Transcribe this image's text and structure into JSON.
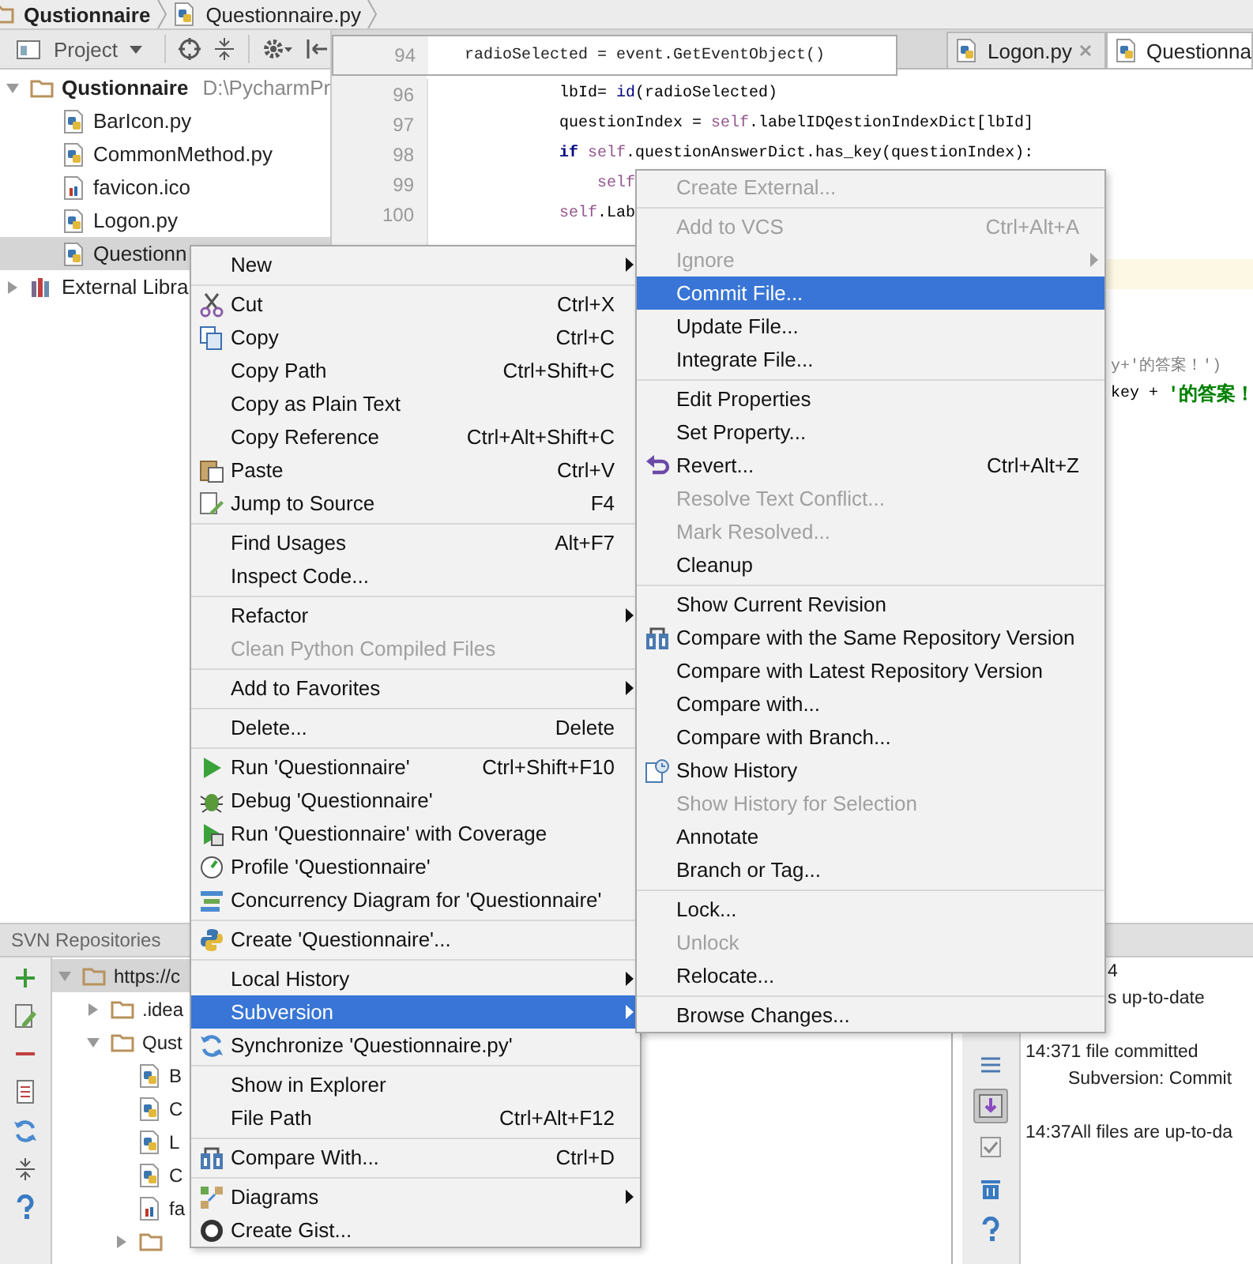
{
  "breadcrumb": [
    {
      "label": "Qustionnaire",
      "kind": "folder"
    },
    {
      "label": "Questionnaire.py",
      "kind": "python"
    }
  ],
  "project_panel": {
    "title": "Project",
    "tree": [
      {
        "label": "Qustionnaire",
        "path": "D:\\PycharmPr",
        "kind": "folder",
        "expanded": true,
        "selected": false,
        "children": [
          {
            "label": "BarIcon.py",
            "kind": "python",
            "selected": false
          },
          {
            "label": "CommonMethod.py",
            "kind": "python",
            "selected": false
          },
          {
            "label": "favicon.ico",
            "kind": "image",
            "selected": false
          },
          {
            "label": "Logon.py",
            "kind": "python",
            "selected": false
          },
          {
            "label": "Questionn",
            "kind": "python",
            "selected": true
          }
        ]
      },
      {
        "label": "External Libra",
        "kind": "library",
        "expanded": false,
        "selected": false
      }
    ]
  },
  "editor": {
    "sticky_line": {
      "number": "94",
      "code": "radioSelected = event.GetEventObject()"
    },
    "tabs": [
      {
        "label": "Logon.py",
        "selected": false,
        "closable": true
      },
      {
        "label": "Questionna",
        "selected": true,
        "closable": false
      }
    ],
    "lines": [
      {
        "number": "96",
        "current": false,
        "nested": false,
        "segments": [
          {
            "text": "lbId= ",
            "kind": "plain"
          },
          {
            "text": "id",
            "kind": "builtin"
          },
          {
            "text": "(radioSelected)",
            "kind": "plain"
          }
        ]
      },
      {
        "number": "97",
        "current": false,
        "nested": false,
        "segments": [
          {
            "text": "questionIndex = ",
            "kind": "plain"
          },
          {
            "text": "self",
            "kind": "self"
          },
          {
            "text": ".labelIDQestionIndexDict[lbId]",
            "kind": "plain"
          }
        ]
      },
      {
        "number": "98",
        "current": false,
        "nested": false,
        "segments": [
          {
            "text": "if",
            "kind": "keyword"
          },
          {
            "text": "self",
            "kind": "self"
          },
          {
            "text": ".questionAnswerDict.has_key(questionIndex):",
            "kind": "plain"
          }
        ]
      },
      {
        "number": "99",
        "current": false,
        "nested": true,
        "segments": [
          {
            "text": "self",
            "kind": "self"
          }
        ]
      },
      {
        "number": "100",
        "current": false,
        "nested": false,
        "segments": [
          {
            "text": "self",
            "kind": "self"
          },
          {
            "text": ".Lab",
            "kind": "plain"
          }
        ]
      },
      {
        "current": false,
        "bulb": true
      },
      {
        "current": true
      }
    ],
    "tails": [
      {
        "segments": [
          {
            "text": "y+'的答案！')",
            "kind": "faded"
          }
        ]
      },
      {
        "segments": [
          {
            "text": "key + ",
            "kind": "plain"
          },
          {
            "text": "'的答案！",
            "kind": "string"
          }
        ]
      }
    ]
  },
  "svn_panel": {
    "title": "SVN Repositories",
    "tree": [
      {
        "label": "https://c",
        "kind": "folder",
        "expanded": true,
        "selected": true,
        "children": [
          {
            "label": ".idea",
            "kind": "folder",
            "expanded": false,
            "selected": false
          },
          {
            "label": "Qust",
            "kind": "folder",
            "expanded": true,
            "selected": false,
            "children": [
              {
                "label": "B",
                "kind": "python",
                "selected": false
              },
              {
                "label": "C",
                "kind": "python",
                "selected": false
              },
              {
                "label": "L",
                "kind": "python",
                "selected": false
              },
              {
                "label": "C",
                "kind": "python",
                "selected": false
              },
              {
                "label": "fa",
                "kind": "image",
                "selected": false
              },
              {
                "kind": "folder",
                "expanded": false,
                "selected": false
              }
            ]
          }
        ]
      }
    ]
  },
  "event_log": {
    "toolbar": [
      {
        "pressed": false
      },
      {
        "pressed": true
      },
      {
        "pressed": false
      },
      {
        "pressed": false
      },
      {
        "pressed": false
      }
    ],
    "entries": [
      {
        "fragments": [
          "4",
          "s up-to-date"
        ]
      },
      {
        "time": "14:37",
        "message": "1 file committed",
        "detail": "Subversion: Commit"
      },
      {
        "time": "14:37",
        "message": "All files are up-to-da"
      }
    ]
  },
  "context_menu": {
    "groups": [
      [
        {
          "label": "New",
          "submenu": true,
          "disabled": false,
          "selected": false
        }
      ],
      [
        {
          "label": "Cut",
          "shortcut": "Ctrl+X",
          "submenu": false,
          "disabled": false,
          "selected": false
        },
        {
          "label": "Copy",
          "shortcut": "Ctrl+C",
          "submenu": false,
          "disabled": false,
          "selected": false
        },
        {
          "label": "Copy Path",
          "shortcut": "Ctrl+Shift+C",
          "submenu": false,
          "disabled": false,
          "selected": false
        },
        {
          "label": "Copy as Plain Text",
          "submenu": false,
          "disabled": false,
          "selected": false
        },
        {
          "label": "Copy Reference",
          "shortcut": "Ctrl+Alt+Shift+C",
          "submenu": false,
          "disabled": false,
          "selected": false
        },
        {
          "label": "Paste",
          "shortcut": "Ctrl+V",
          "submenu": false,
          "disabled": false,
          "selected": false
        },
        {
          "label": "Jump to Source",
          "shortcut": "F4",
          "submenu": false,
          "disabled": false,
          "selected": false
        }
      ],
      [
        {
          "label": "Find Usages",
          "shortcut": "Alt+F7",
          "submenu": false,
          "disabled": false,
          "selected": false
        },
        {
          "label": "Inspect Code...",
          "submenu": false,
          "disabled": false,
          "selected": false
        }
      ],
      [
        {
          "label": "Refactor",
          "submenu": true,
          "disabled": false,
          "selected": false
        },
        {
          "label": "Clean Python Compiled Files",
          "submenu": false,
          "disabled": true,
          "selected": false
        }
      ],
      [
        {
          "label": "Add to Favorites",
          "submenu": true,
          "disabled": false,
          "selected": false
        }
      ],
      [
        {
          "label": "Delete...",
          "shortcut": "Delete",
          "submenu": false,
          "disabled": false,
          "selected": false
        }
      ],
      [
        {
          "label": "Run 'Questionnaire'",
          "shortcut": "Ctrl+Shift+F10",
          "submenu": false,
          "disabled": false,
          "selected": false
        },
        {
          "label": "Debug 'Questionnaire'",
          "submenu": false,
          "disabled": false,
          "selected": false
        },
        {
          "label": "Run 'Questionnaire' with Coverage",
          "submenu": false,
          "disabled": false,
          "selected": false
        },
        {
          "label": "Profile 'Questionnaire'",
          "submenu": false,
          "disabled": false,
          "selected": false
        },
        {
          "label": "Concurrency Diagram for  'Questionnaire'",
          "submenu": false,
          "disabled": false,
          "selected": false
        }
      ],
      [
        {
          "label": "Create 'Questionnaire'...",
          "submenu": false,
          "disabled": false,
          "selected": false
        }
      ],
      [
        {
          "label": "Local History",
          "submenu": true,
          "disabled": false,
          "selected": false
        },
        {
          "label": "Subversion",
          "submenu": true,
          "disabled": false,
          "selected": true
        },
        {
          "label": "Synchronize 'Questionnaire.py'",
          "submenu": false,
          "disabled": false,
          "selected": false
        }
      ],
      [
        {
          "label": "Show in Explorer",
          "submenu": false,
          "disabled": false,
          "selected": false
        },
        {
          "label": "File Path",
          "shortcut": "Ctrl+Alt+F12",
          "submenu": false,
          "disabled": false,
          "selected": false
        }
      ],
      [
        {
          "label": "Compare With...",
          "shortcut": "Ctrl+D",
          "submenu": false,
          "disabled": false,
          "selected": false
        }
      ],
      [
        {
          "label": "Diagrams",
          "submenu": true,
          "disabled": false,
          "selected": false
        },
        {
          "label": "Create Gist...",
          "submenu": false,
          "disabled": false,
          "selected": false
        }
      ]
    ]
  },
  "subversion_menu": {
    "groups": [
      [
        {
          "label": "Create External...",
          "submenu": false,
          "disabled": true,
          "selected": false
        }
      ],
      [
        {
          "label": "Add to VCS",
          "shortcut": "Ctrl+Alt+A",
          "submenu": false,
          "disabled": true,
          "selected": false
        },
        {
          "label": "Ignore",
          "submenu": true,
          "disabled": true,
          "selected": false
        },
        {
          "label": "Commit File...",
          "submenu": false,
          "disabled": false,
          "selected": true
        },
        {
          "label": "Update File...",
          "submenu": false,
          "disabled": false,
          "selected": false
        },
        {
          "label": "Integrate File...",
          "submenu": false,
          "disabled": false,
          "selected": false
        }
      ],
      [
        {
          "label": "Edit Properties",
          "submenu": false,
          "disabled": false,
          "selected": false
        },
        {
          "label": "Set Property...",
          "submenu": false,
          "disabled": false,
          "selected": false
        },
        {
          "label": "Revert...",
          "shortcut": "Ctrl+Alt+Z",
          "submenu": false,
          "disabled": false,
          "selected": false
        },
        {
          "label": "Resolve Text Conflict...",
          "submenu": false,
          "disabled": true,
          "selected": false
        },
        {
          "label": "Mark Resolved...",
          "submenu": false,
          "disabled": true,
          "selected": false
        },
        {
          "label": "Cleanup",
          "submenu": false,
          "disabled": false,
          "selected": false
        }
      ],
      [
        {
          "label": "Show Current Revision",
          "submenu": false,
          "disabled": false,
          "selected": false
        },
        {
          "label": "Compare with the Same Repository Version",
          "submenu": false,
          "disabled": false,
          "selected": false
        },
        {
          "label": "Compare with Latest Repository Version",
          "submenu": false,
          "disabled": false,
          "selected": false
        },
        {
          "label": "Compare with...",
          "submenu": false,
          "disabled": false,
          "selected": false
        },
        {
          "label": "Compare with Branch...",
          "submenu": false,
          "disabled": false,
          "selected": false
        },
        {
          "label": "Show History",
          "submenu": false,
          "disabled": false,
          "selected": false
        },
        {
          "label": "Show History for Selection",
          "submenu": false,
          "disabled": true,
          "selected": false
        },
        {
          "label": "Annotate",
          "submenu": false,
          "disabled": false,
          "selected": false
        },
        {
          "label": "Branch or Tag...",
          "submenu": false,
          "disabled": false,
          "selected": false
        }
      ],
      [
        {
          "label": "Lock...",
          "submenu": false,
          "disabled": false,
          "selected": false
        },
        {
          "label": "Unlock",
          "submenu": false,
          "disabled": true,
          "selected": false
        },
        {
          "label": "Relocate...",
          "submenu": false,
          "disabled": false,
          "selected": false
        }
      ],
      [
        {
          "label": "Browse Changes...",
          "submenu": false,
          "disabled": false,
          "selected": false
        }
      ]
    ]
  }
}
